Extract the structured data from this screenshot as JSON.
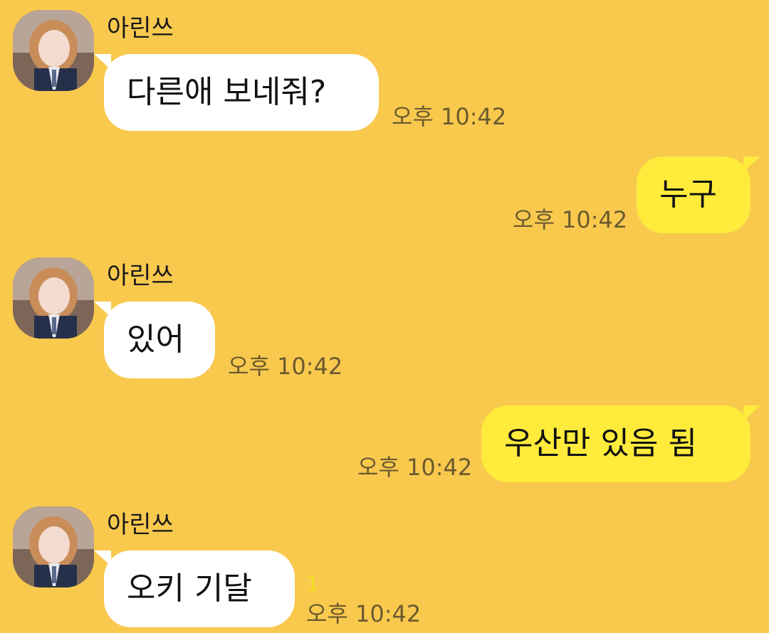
{
  "colors": {
    "background": "#F9C94E",
    "incoming_bubble": "#FFFFFF",
    "outgoing_bubble": "#FEEB3B",
    "timestamp": "#6b5a2f",
    "unread_count": "#F2E21F"
  },
  "messages": [
    {
      "direction": "incoming",
      "sender": "아린쓰",
      "avatar_icon": "profile-photo-icon",
      "text": "다른애 보네줘?",
      "time": "오후 10:42"
    },
    {
      "direction": "outgoing",
      "text": "누구",
      "time": "오후 10:42"
    },
    {
      "direction": "incoming",
      "sender": "아린쓰",
      "avatar_icon": "profile-photo-icon",
      "text": "있어",
      "time": "오후 10:42"
    },
    {
      "direction": "outgoing",
      "text": "우산만 있음 됨",
      "time": "오후 10:42"
    },
    {
      "direction": "incoming",
      "sender": "아린쓰",
      "avatar_icon": "profile-photo-icon",
      "text": "오키 기달",
      "time": "오후 10:42",
      "unread": "1"
    }
  ]
}
